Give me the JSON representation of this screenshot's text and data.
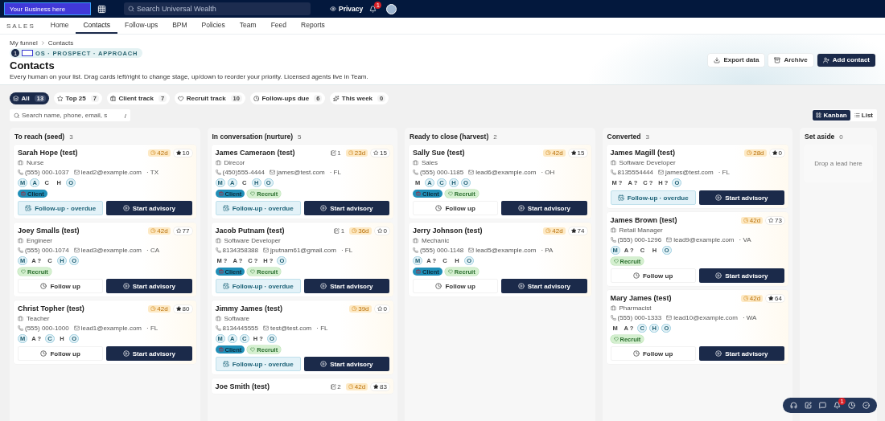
{
  "topbar": {
    "logo": "Your Business here",
    "search_placeholder": "Search Universal Wealth",
    "privacy": "Privacy",
    "notifications_badge": "1"
  },
  "nav": {
    "section": "SALES",
    "tabs": [
      {
        "label": "Home",
        "selected": false
      },
      {
        "label": "Contacts",
        "selected": true
      },
      {
        "label": "Follow-ups",
        "selected": false
      },
      {
        "label": "BPM",
        "selected": false
      },
      {
        "label": "Policies",
        "selected": false
      },
      {
        "label": "Team",
        "selected": false
      },
      {
        "label": "Feed",
        "selected": false
      },
      {
        "label": "Reports",
        "selected": false
      }
    ]
  },
  "header": {
    "breadcrumb": [
      "My funnel",
      "Contacts"
    ],
    "step_number": "1",
    "step_label": "OS · PROSPECT · APPROACH",
    "title": "Contacts",
    "subtitle": "Every human on your list. Drag cards left/right to change stage, up/down to reorder your priority. Licensed agents live in Team.",
    "actions": [
      {
        "kind": "export",
        "label": "Export data"
      },
      {
        "kind": "archive",
        "label": "Archive"
      },
      {
        "kind": "add",
        "label": "Add contact"
      }
    ]
  },
  "filters": [
    {
      "kind": "all",
      "label": "All",
      "count": "13",
      "selected": true
    },
    {
      "kind": "top",
      "label": "Top 25",
      "count": "7",
      "selected": false
    },
    {
      "kind": "client",
      "label": "Client track",
      "count": "7",
      "selected": false
    },
    {
      "kind": "recruit",
      "label": "Recruit track",
      "count": "10",
      "selected": false
    },
    {
      "kind": "due",
      "label": "Follow-ups due",
      "count": "6",
      "selected": false
    },
    {
      "kind": "week",
      "label": "This week",
      "count": "0",
      "selected": false
    }
  ],
  "search": {
    "placeholder": "Search name, phone, email, s",
    "shortcut": "/"
  },
  "views": [
    {
      "kind": "kanban",
      "label": "Kanban",
      "selected": true
    },
    {
      "kind": "list",
      "label": "List",
      "selected": false
    }
  ],
  "columns": [
    {
      "title": "To reach (seed)",
      "count": "3",
      "cards": [
        {
          "name": "Sarah Hope (test)",
          "age": "42d",
          "starred": true,
          "score": "10",
          "job": "Nurse",
          "phone": "(555) 000-1037",
          "email": "lead2@example.com",
          "state": "· TX",
          "stages": [
            {
              "label": "M",
              "done": true
            },
            {
              "label": "A",
              "done": true
            },
            {
              "label": "C",
              "done": false
            },
            {
              "label": "H",
              "done": false
            },
            {
              "label": "O",
              "done": true
            }
          ],
          "tags": [
            {
              "kind": "client",
              "label": "Client"
            }
          ],
          "follow": {
            "kind": "overdue",
            "label": "Follow-up · overdue"
          },
          "advisory": "Start advisory"
        },
        {
          "name": "Joey Smalls (test)",
          "age": "42d",
          "starred": false,
          "score": "77",
          "job": "Engineer",
          "phone": "(555) 000-1074",
          "email": "lead3@example.com",
          "state": "· CA",
          "stages": [
            {
              "label": "M",
              "done": true
            },
            {
              "label": "A ?",
              "done": false
            },
            {
              "label": "C",
              "done": false
            },
            {
              "label": "H",
              "done": true
            },
            {
              "label": "O",
              "done": true
            }
          ],
          "tags": [
            {
              "kind": "recruit",
              "label": "Recruit"
            }
          ],
          "follow": {
            "kind": "plain",
            "label": "Follow up"
          },
          "advisory": "Start advisory"
        },
        {
          "name": "Christ Topher (test)",
          "age": "42d",
          "starred": true,
          "score": "80",
          "job": "Teacher",
          "phone": "(555) 000-1000",
          "email": "lead1@example.com",
          "state": "· FL",
          "stages": [
            {
              "label": "M",
              "done": true
            },
            {
              "label": "A ?",
              "done": false
            },
            {
              "label": "C",
              "done": true
            },
            {
              "label": "H",
              "done": false
            },
            {
              "label": "O",
              "done": true
            }
          ],
          "follow": {
            "kind": "plain",
            "label": "Follow up"
          },
          "advisory": "Start advisory"
        }
      ]
    },
    {
      "title": "In conversation (nurture)",
      "count": "5",
      "cards": [
        {
          "name": "James Cameraon (test)",
          "notes": "1",
          "age": "23d",
          "starred": false,
          "score": "15",
          "job": "Direcor",
          "phone": "(450)555-4444",
          "email": "james@test.com",
          "state": "· FL",
          "stages": [
            {
              "label": "M",
              "done": true
            },
            {
              "label": "A",
              "done": true
            },
            {
              "label": "C",
              "done": false
            },
            {
              "label": "H",
              "done": true
            },
            {
              "label": "O",
              "done": true
            }
          ],
          "tags": [
            {
              "kind": "client",
              "label": "Client"
            },
            {
              "kind": "recruit",
              "label": "Recruit"
            }
          ],
          "follow": {
            "kind": "overdue",
            "label": "Follow-up · overdue"
          },
          "advisory": "Start advisory"
        },
        {
          "name": "Jacob Putnam (test)",
          "notes": "1",
          "age": "36d",
          "starred": false,
          "score": "0",
          "job": "Software Developer",
          "phone": "8134358388",
          "email": "jputnam61@gmail.com",
          "state": "· FL",
          "stages": [
            {
              "label": "M ?",
              "done": false
            },
            {
              "label": "A ?",
              "done": false
            },
            {
              "label": "C ?",
              "done": false
            },
            {
              "label": "H ?",
              "done": false
            },
            {
              "label": "O",
              "done": true
            }
          ],
          "tags": [
            {
              "kind": "client",
              "label": "Client"
            },
            {
              "kind": "recruit",
              "label": "Recruit"
            }
          ],
          "follow": {
            "kind": "overdue",
            "label": "Follow-up · overdue"
          },
          "advisory": "Start advisory"
        },
        {
          "name": "Jimmy James (test)",
          "age": "39d",
          "starred": false,
          "score": "0",
          "job": "Software",
          "phone": "8134445555",
          "email": "test@test.com",
          "state": "· FL",
          "stages": [
            {
              "label": "M",
              "done": true
            },
            {
              "label": "A",
              "done": true
            },
            {
              "label": "C",
              "done": true
            },
            {
              "label": "H ?",
              "done": false
            },
            {
              "label": "O",
              "done": true
            }
          ],
          "tags": [
            {
              "kind": "client",
              "label": "Client"
            },
            {
              "kind": "recruit",
              "label": "Recruit"
            }
          ],
          "follow": {
            "kind": "overdue",
            "label": "Follow-up · overdue"
          },
          "advisory": "Start advisory"
        },
        {
          "name": "Joe Smith (test)",
          "notes": "2",
          "age": "42d",
          "starred": true,
          "score": "83"
        }
      ]
    },
    {
      "title": "Ready to close (harvest)",
      "count": "2",
      "cards": [
        {
          "name": "Sally Sue (test)",
          "age": "42d",
          "starred": true,
          "score": "15",
          "job": "Sales",
          "phone": "(555) 000-1185",
          "email": "lead6@example.com",
          "state": "· OH",
          "stages": [
            {
              "label": "M",
              "done": false
            },
            {
              "label": "A",
              "done": true
            },
            {
              "label": "C",
              "done": true
            },
            {
              "label": "H",
              "done": true
            },
            {
              "label": "O",
              "done": true
            }
          ],
          "tags": [
            {
              "kind": "client",
              "label": "Client"
            },
            {
              "kind": "recruit",
              "label": "Recruit"
            }
          ],
          "follow": {
            "kind": "plain",
            "label": "Follow up"
          },
          "advisory": "Start advisory"
        },
        {
          "name": "Jerry Johnson (test)",
          "age": "42d",
          "starred": true,
          "score": "74",
          "job": "Mechanic",
          "phone": "(555) 000-1148",
          "email": "lead5@example.com",
          "state": "· PA",
          "stages": [
            {
              "label": "M",
              "done": true
            },
            {
              "label": "A ?",
              "done": false
            },
            {
              "label": "C",
              "done": false
            },
            {
              "label": "H",
              "done": false
            },
            {
              "label": "O",
              "done": true
            }
          ],
          "tags": [
            {
              "kind": "client",
              "label": "Client"
            },
            {
              "kind": "recruit",
              "label": "Recruit"
            }
          ],
          "follow": {
            "kind": "plain",
            "label": "Follow up"
          },
          "advisory": "Start advisory"
        }
      ]
    },
    {
      "title": "Converted",
      "count": "3",
      "cards": [
        {
          "name": "James Magill (test)",
          "age": "28d",
          "starred": true,
          "score": "0",
          "job": "Software Developer",
          "phone": "8135554444",
          "email": "james@test.com",
          "state": "· FL",
          "stages": [
            {
              "label": "M ?",
              "done": false
            },
            {
              "label": "A ?",
              "done": false
            },
            {
              "label": "C ?",
              "done": false
            },
            {
              "label": "H ?",
              "done": false
            },
            {
              "label": "O",
              "done": true
            }
          ],
          "follow": {
            "kind": "overdue",
            "label": "Follow-up · overdue"
          },
          "advisory": "Start advisory"
        },
        {
          "name": "James Brown (test)",
          "age": "42d",
          "starred": false,
          "score": "73",
          "job": "Retail Manager",
          "phone": "(555) 000-1296",
          "email": "lead9@example.com",
          "state": "· VA",
          "stages": [
            {
              "label": "M",
              "done": true
            },
            {
              "label": "A ?",
              "done": false
            },
            {
              "label": "C",
              "done": false
            },
            {
              "label": "H",
              "done": false
            },
            {
              "label": "O",
              "done": true
            }
          ],
          "tags": [
            {
              "kind": "recruit",
              "label": "Recruit"
            }
          ],
          "follow": {
            "kind": "plain",
            "label": "Follow up"
          },
          "advisory": "Start advisory"
        },
        {
          "name": "Mary James (test)",
          "age": "42d",
          "starred": true,
          "score": "64",
          "job": "Pharmacist",
          "phone": "(555) 000-1333",
          "email": "lead10@example.com",
          "state": "· WA",
          "stages": [
            {
              "label": "M",
              "done": false
            },
            {
              "label": "A ?",
              "done": false
            },
            {
              "label": "C",
              "done": true
            },
            {
              "label": "H",
              "done": true
            },
            {
              "label": "O",
              "done": true
            }
          ],
          "tags": [
            {
              "kind": "recruit",
              "label": "Recruit"
            }
          ],
          "follow": {
            "kind": "plain",
            "label": "Follow up"
          },
          "advisory": "Start advisory"
        }
      ]
    },
    {
      "title": "Set aside",
      "count": "0",
      "empty": "Drop a lead here"
    }
  ],
  "dock": [
    {
      "kind": "support"
    },
    {
      "kind": "compose"
    },
    {
      "kind": "chat"
    },
    {
      "kind": "alerts",
      "badge": "1"
    },
    {
      "kind": "history"
    },
    {
      "kind": "done"
    }
  ]
}
